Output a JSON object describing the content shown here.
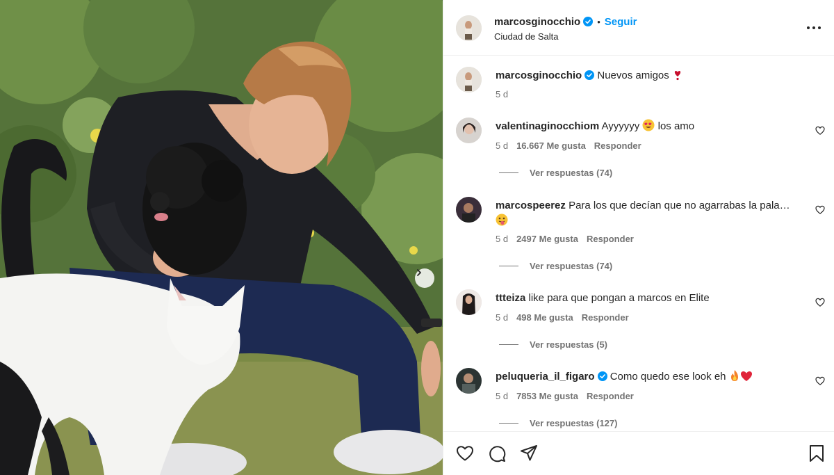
{
  "post": {
    "username": "marcosginocchio",
    "follow_label": "Seguir",
    "separator": "•",
    "location": "Ciudad de Salta",
    "caption_user": "marcosginocchio",
    "caption_text": "Nuevos amigos",
    "caption_time": "5 d"
  },
  "comments": [
    {
      "user": "valentinaginocchiom",
      "text": "Ayyyyyy",
      "text2": "los amo",
      "time": "5 d",
      "likes": "16.667 Me gusta",
      "reply": "Responder",
      "view_replies": "Ver respuestas (74)"
    },
    {
      "user": "marcospeerez",
      "text": "Para los que decían que no agarrabas la pala…",
      "time": "5 d",
      "likes": "2497 Me gusta",
      "reply": "Responder",
      "view_replies": "Ver respuestas (74)"
    },
    {
      "user": "ttteiza",
      "text": "like para que pongan a marcos en Elite",
      "time": "5 d",
      "likes": "498 Me gusta",
      "reply": "Responder",
      "view_replies": "Ver respuestas (5)"
    },
    {
      "user": "peluqueria_il_figaro",
      "text": "Como quedo ese look eh",
      "time": "5 d",
      "likes": "7853 Me gusta",
      "reply": "Responder",
      "view_replies": "Ver respuestas (127)"
    }
  ],
  "icons": {
    "verified": "verified-badge-icon",
    "more": "more-options-icon",
    "like": "heart-icon",
    "comment": "comment-icon",
    "share": "send-icon",
    "save": "bookmark-icon",
    "next": "chevron-right-icon"
  },
  "colors": {
    "accent": "#0095f6",
    "text": "#262626",
    "muted": "#737373",
    "border": "#efefef"
  }
}
